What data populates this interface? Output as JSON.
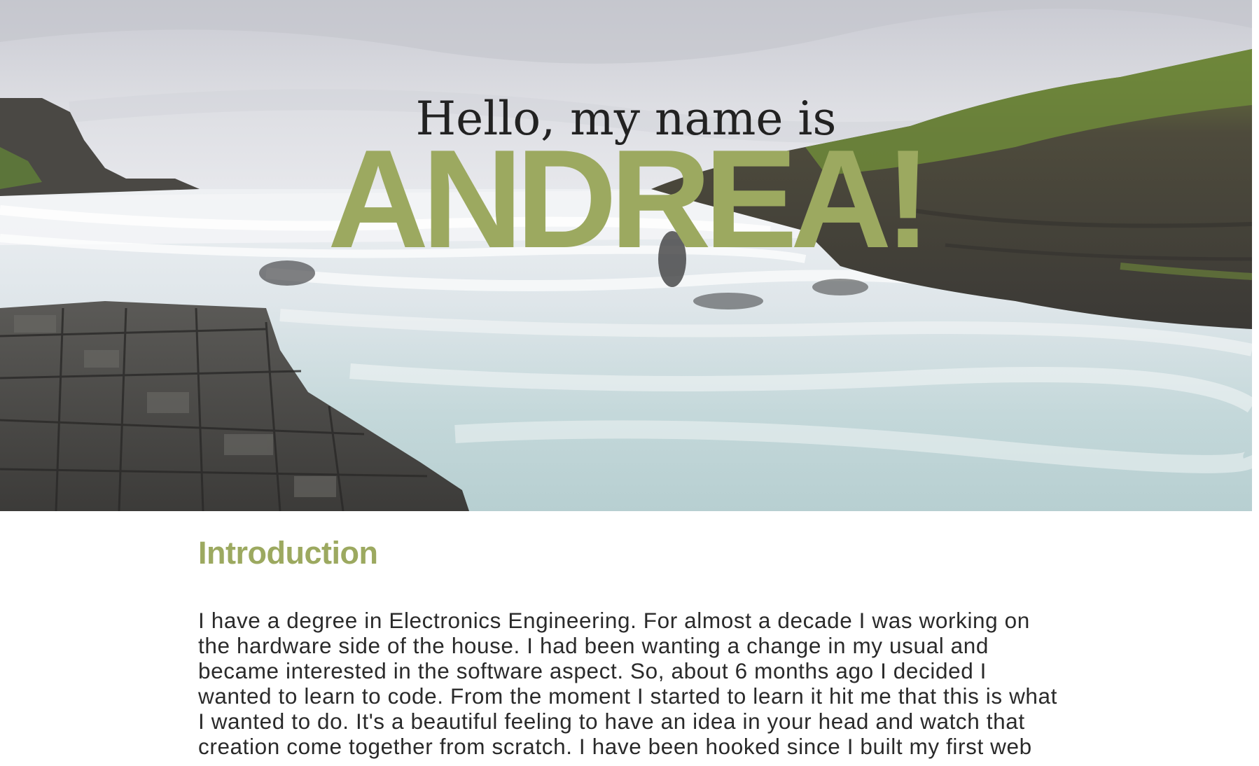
{
  "hero": {
    "greeting": "Hello, my name is",
    "name": "ANDREA!",
    "image_description_icon": "waterfall-landscape-image"
  },
  "intro": {
    "title": "Introduction",
    "body": "I have a degree in Electronics Engineering. For almost a decade I was working on the hardware side of the house. I had been wanting a change in my usual and became interested in the software aspect. So, about 6 months ago I decided I wanted to learn to code. From the moment I started to learn it hit me that this is what I wanted to do. It's a beautiful feeling to have an idea in your head and watch that creation come together from scratch. I have been hooked since I built my first web page."
  },
  "colors": {
    "accent": "#9ca960",
    "text": "#2a2a2a",
    "greeting": "#222222"
  }
}
